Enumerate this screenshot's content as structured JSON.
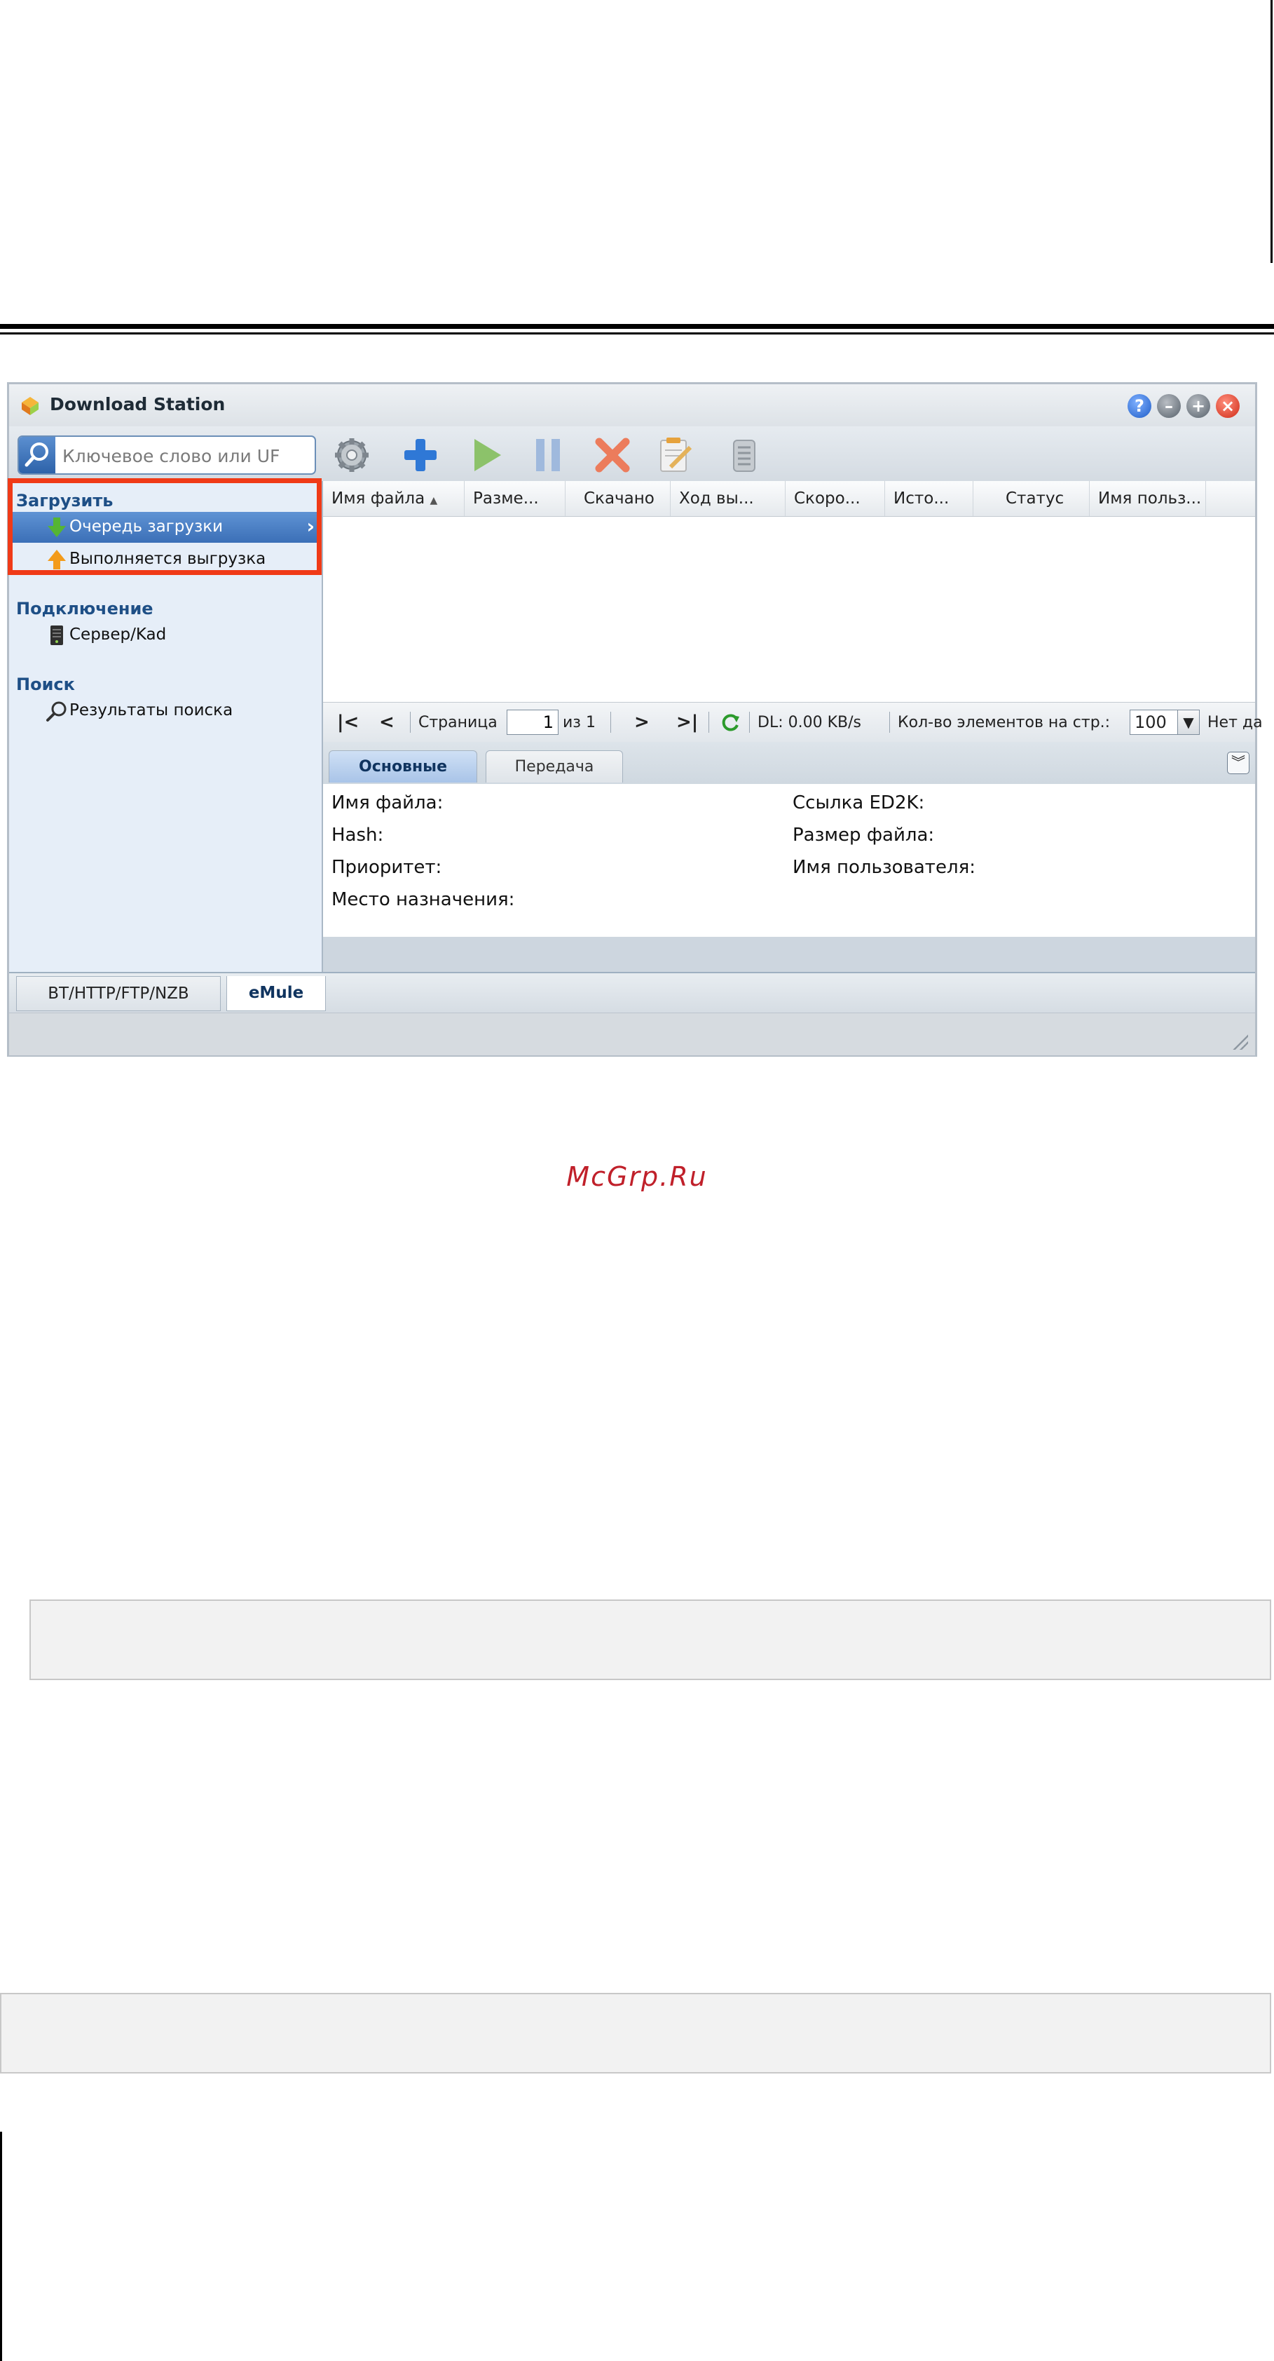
{
  "window": {
    "title": "Download Station",
    "controls": [
      "help",
      "minimize",
      "maximize",
      "close"
    ]
  },
  "toolbar": {
    "search_placeholder": "Ключевое слово или UF",
    "tools": [
      "gear-icon",
      "add-icon",
      "play-icon",
      "pause-icon",
      "delete-icon",
      "edit-icon",
      "clear-icon"
    ]
  },
  "sidebar": {
    "sections": [
      {
        "title": "Загрузить",
        "items": [
          "Очередь загрузки",
          "Выполняется выгрузка"
        ]
      },
      {
        "title": "Подключение",
        "items": [
          "Сервер/Kad"
        ]
      },
      {
        "title": "Поиск",
        "items": [
          "Результаты поиска"
        ]
      }
    ],
    "selected": "Очередь загрузки"
  },
  "grid": {
    "columns": [
      "Имя файла",
      "Разме...",
      "Скачано",
      "Ход вы...",
      "Скоро...",
      "Исто...",
      "Статус",
      "Имя польз..."
    ],
    "sorted_column": "Имя файла",
    "rows": []
  },
  "pager": {
    "page_label": "Страница",
    "page_value": "1",
    "of_label": "из 1",
    "dl_speed": "DL: 0.00 KB/s",
    "per_page_label": "Кол-во элементов на стр.:",
    "per_page_value": "100",
    "no_data": "Нет да"
  },
  "detail": {
    "tabs": [
      "Основные",
      "Передача"
    ],
    "active_tab": "Основные",
    "labels": {
      "file_name": "Имя файла:",
      "ed2k_link": "Ссылка ED2K:",
      "hash": "Hash:",
      "file_size": "Размер файла:",
      "priority": "Приоритет:",
      "user_name": "Имя пользователя:",
      "destination": "Место назначения:"
    }
  },
  "bottom_tabs": [
    "BT/HTTP/FTP/NZB",
    "eMule"
  ],
  "active_bottom_tab": "eMule",
  "watermark": "McGrp.Ru",
  "colors": {
    "highlight_frame": "#f03a17",
    "selection": "#3b6fb7",
    "watermark": "#c0202a"
  }
}
